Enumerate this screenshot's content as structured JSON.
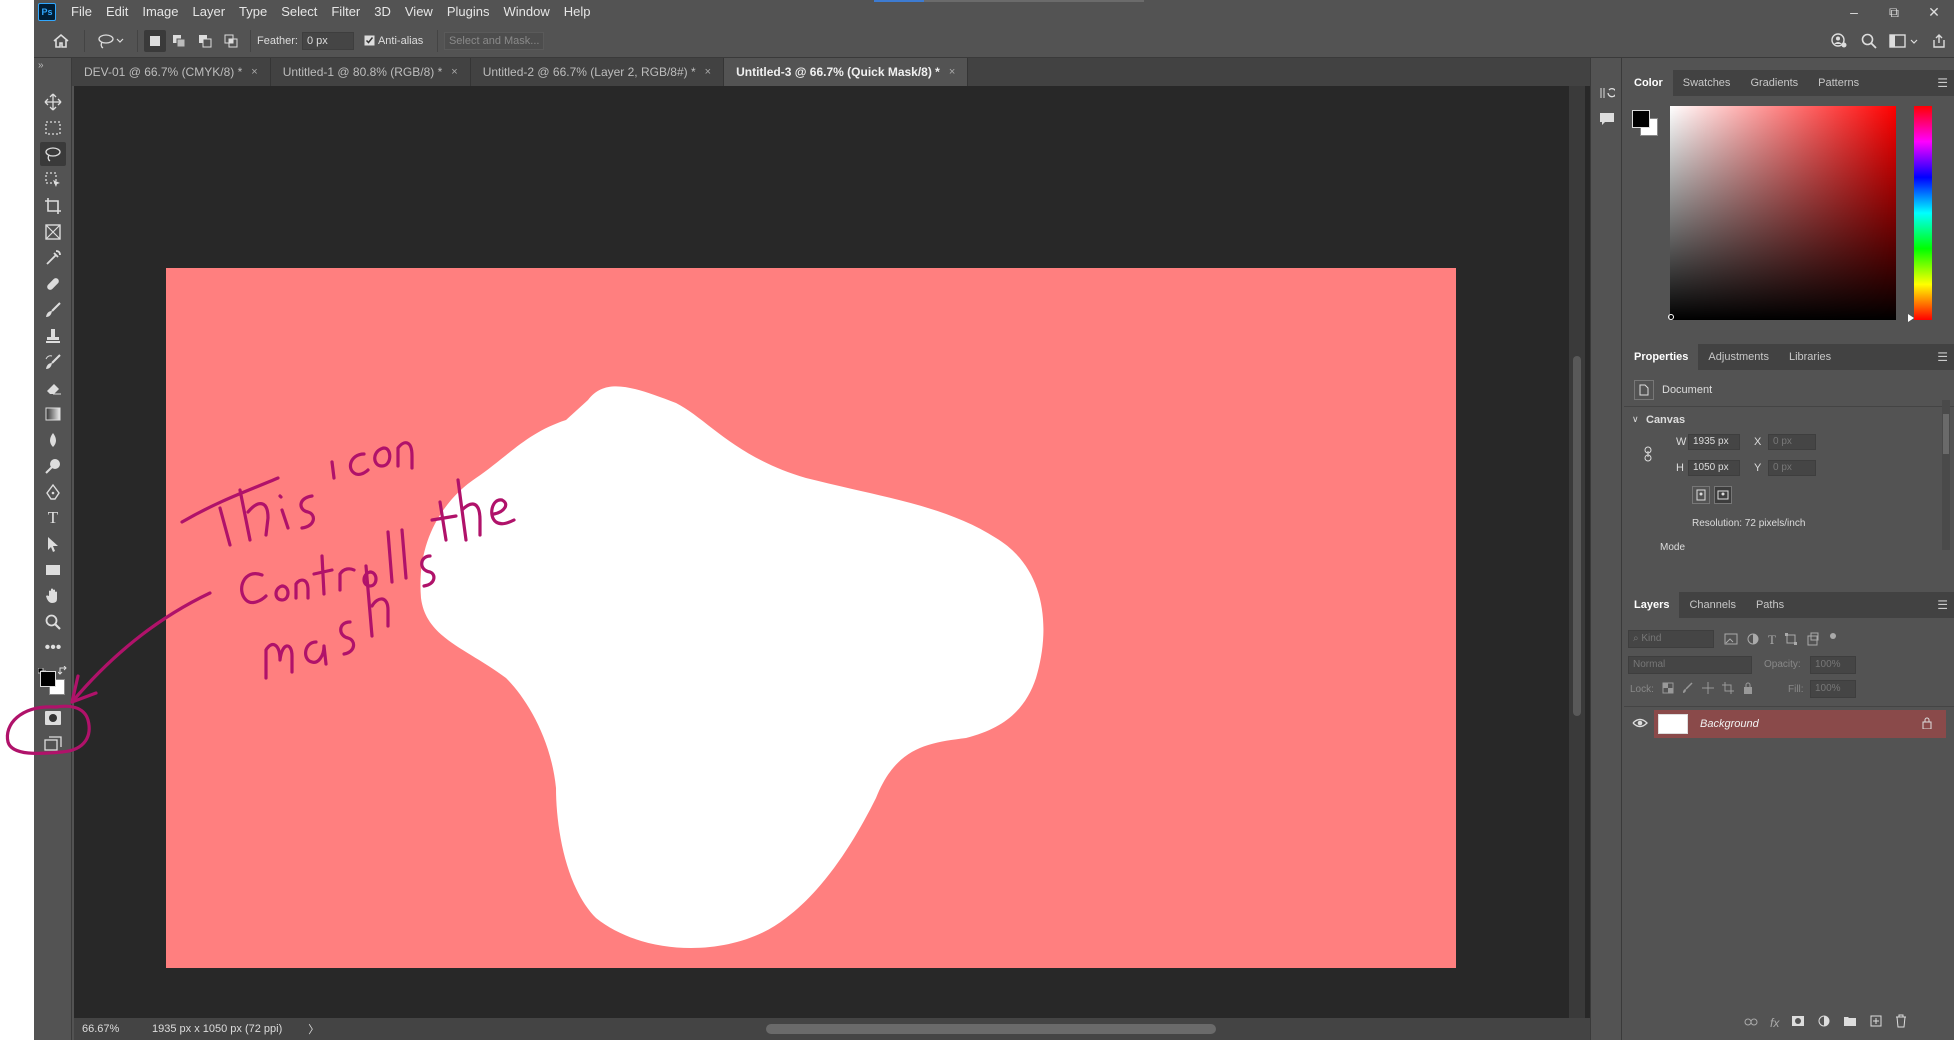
{
  "app": {
    "logo": "Ps"
  },
  "menu": [
    "File",
    "Edit",
    "Image",
    "Layer",
    "Type",
    "Select",
    "Filter",
    "3D",
    "View",
    "Plugins",
    "Window",
    "Help"
  ],
  "window_controls": {
    "minimize": "–",
    "restore": "⧉",
    "close": "✕"
  },
  "options": {
    "feather_label": "Feather:",
    "feather_value": "0 px",
    "antialias_label": "Anti-alias",
    "select_mask_label": "Select and Mask..."
  },
  "tabs": [
    {
      "label": "DEV-01 @ 66.7% (CMYK/8) *",
      "active": false
    },
    {
      "label": "Untitled-1 @ 80.8% (RGB/8) *",
      "active": false
    },
    {
      "label": "Untitled-2 @ 66.7% (Layer 2, RGB/8#) *",
      "active": false
    },
    {
      "label": "Untitled-3 @ 66.7% (Quick Mask/8) *",
      "active": true
    }
  ],
  "tab_close": "×",
  "status": {
    "zoom": "66.67%",
    "doc_info": "1935 px x 1050 px (72 ppi)",
    "arrow": "〉"
  },
  "color_panel": {
    "tabs": [
      "Color",
      "Swatches",
      "Gradients",
      "Patterns"
    ]
  },
  "properties_panel": {
    "tabs": [
      "Properties",
      "Adjustments",
      "Libraries"
    ],
    "doc_label": "Document",
    "section": "Canvas",
    "w_label": "W",
    "w_value": "1935 px",
    "h_label": "H",
    "h_value": "1050 px",
    "x_label": "X",
    "x_placeholder": "0 px",
    "y_label": "Y",
    "y_placeholder": "0 px",
    "resolution": "Resolution: 72 pixels/inch",
    "mode_label": "Mode"
  },
  "layers_panel": {
    "tabs": [
      "Layers",
      "Channels",
      "Paths"
    ],
    "kind_placeholder": "Kind",
    "blend_mode": "Normal",
    "opacity_label": "Opacity:",
    "opacity_value": "100%",
    "lock_label": "Lock:",
    "fill_label": "Fill:",
    "fill_value": "100%",
    "layers": [
      {
        "name": "Background",
        "visible": true,
        "locked": true
      }
    ]
  },
  "annotation": {
    "color": "#b0126a"
  },
  "colors": {
    "document": "#ff7f7f",
    "workspace": "#282828",
    "ui": "#535353"
  }
}
